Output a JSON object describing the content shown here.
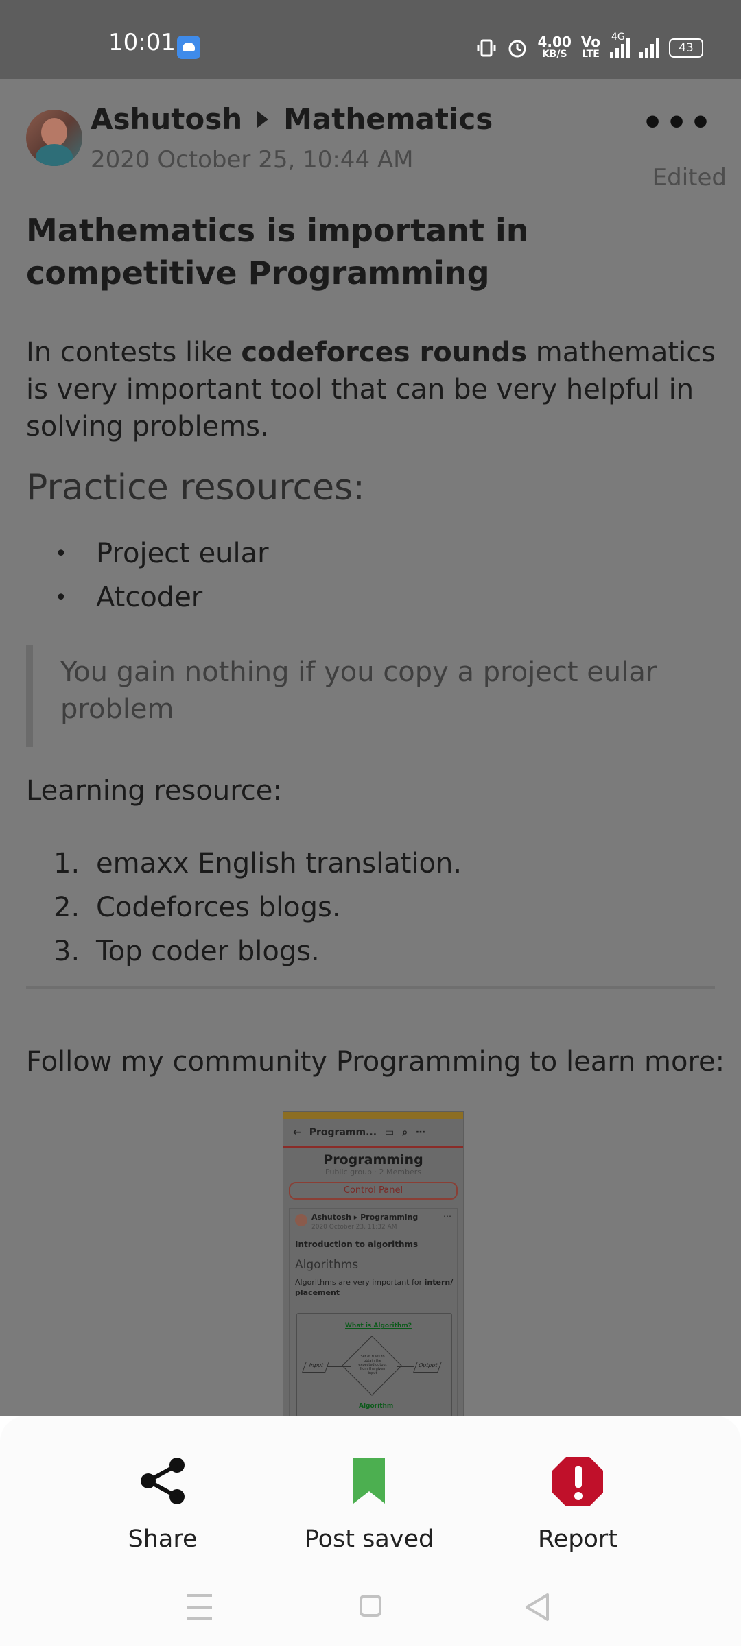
{
  "status": {
    "time": "10:01",
    "network_speed": "4.00",
    "network_unit": "KB/S",
    "volte": "Vo",
    "lte": "LTE",
    "signal_4g": "4G",
    "battery": "43"
  },
  "post": {
    "author": "Ashutosh",
    "community": "Mathematics",
    "timestamp": "2020 October 25, 10:44 AM",
    "edited": "Edited",
    "title": "Mathematics is important in competitive Programming",
    "para_before": "In contests like ",
    "para_bold": "codeforces rounds",
    "para_after": " mathematics is very important tool that can be very helpful in solving problems.",
    "practice_heading": "Practice resources:",
    "practice_items": [
      "Project eular",
      "Atcoder"
    ],
    "quote": "You gain nothing if you copy a project eular problem",
    "learning_heading": "Learning resource:",
    "learning_items": [
      "emaxx English translation.",
      "Codeforces blogs.",
      "Top coder blogs."
    ],
    "follow_text": "Follow my community Programming to learn more:"
  },
  "preview": {
    "nav_title": "Programm...",
    "group_name": "Programming",
    "group_meta": "Public group · 2 Members",
    "control_panel": "Control Panel",
    "card_author": "Ashutosh",
    "card_community": "Programming",
    "card_date": "2020 October 23, 11:32 AM",
    "card_title": "Introduction to algorithms",
    "card_subtitle": "Algorithms",
    "card_text_before": "Algorithms are very important for ",
    "card_text_bold": "intern/ placement",
    "flow_heading": "What is Algorithm?",
    "flow_input": "Input",
    "flow_output": "Output",
    "flow_box": "Set of rules to obtain the expected output from the given input",
    "flow_caption": "Algorithm"
  },
  "sheet": {
    "share": "Share",
    "saved": "Post saved",
    "report": "Report"
  },
  "colors": {
    "saved_green": "#4caf50",
    "report_red": "#c0102a"
  }
}
